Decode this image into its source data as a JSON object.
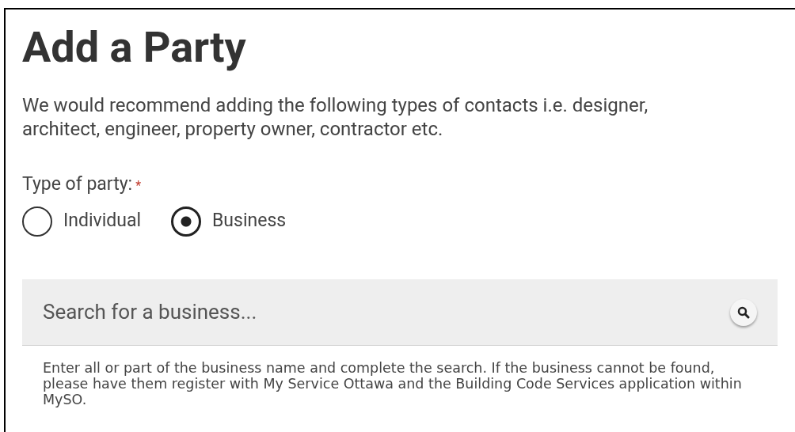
{
  "title": "Add a Party",
  "intro": "We would recommend adding the following types of contacts i.e. designer, architect, engineer, property owner, contractor etc.",
  "party_type": {
    "label": "Type of party:",
    "required_mark": "*",
    "options": [
      {
        "label": "Individual",
        "selected": false
      },
      {
        "label": "Business",
        "selected": true
      }
    ]
  },
  "search": {
    "placeholder": "Search for a business..."
  },
  "help": "Enter all or part of the business name and complete the search. If the business cannot be found, please have them register with My Service Ottawa and the Building Code Services application within MySO."
}
